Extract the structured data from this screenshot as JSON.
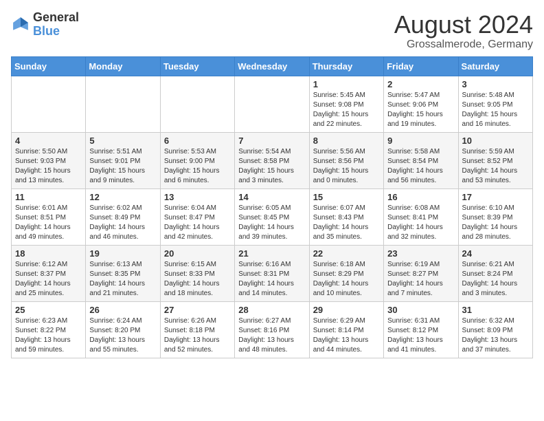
{
  "header": {
    "logo": {
      "line1": "General",
      "line2": "Blue"
    },
    "title": "August 2024",
    "location": "Grossalmerode, Germany"
  },
  "days_of_week": [
    "Sunday",
    "Monday",
    "Tuesday",
    "Wednesday",
    "Thursday",
    "Friday",
    "Saturday"
  ],
  "weeks": [
    [
      {
        "day": "",
        "info": ""
      },
      {
        "day": "",
        "info": ""
      },
      {
        "day": "",
        "info": ""
      },
      {
        "day": "",
        "info": ""
      },
      {
        "day": "1",
        "info": "Sunrise: 5:45 AM\nSunset: 9:08 PM\nDaylight: 15 hours\nand 22 minutes."
      },
      {
        "day": "2",
        "info": "Sunrise: 5:47 AM\nSunset: 9:06 PM\nDaylight: 15 hours\nand 19 minutes."
      },
      {
        "day": "3",
        "info": "Sunrise: 5:48 AM\nSunset: 9:05 PM\nDaylight: 15 hours\nand 16 minutes."
      }
    ],
    [
      {
        "day": "4",
        "info": "Sunrise: 5:50 AM\nSunset: 9:03 PM\nDaylight: 15 hours\nand 13 minutes."
      },
      {
        "day": "5",
        "info": "Sunrise: 5:51 AM\nSunset: 9:01 PM\nDaylight: 15 hours\nand 9 minutes."
      },
      {
        "day": "6",
        "info": "Sunrise: 5:53 AM\nSunset: 9:00 PM\nDaylight: 15 hours\nand 6 minutes."
      },
      {
        "day": "7",
        "info": "Sunrise: 5:54 AM\nSunset: 8:58 PM\nDaylight: 15 hours\nand 3 minutes."
      },
      {
        "day": "8",
        "info": "Sunrise: 5:56 AM\nSunset: 8:56 PM\nDaylight: 15 hours\nand 0 minutes."
      },
      {
        "day": "9",
        "info": "Sunrise: 5:58 AM\nSunset: 8:54 PM\nDaylight: 14 hours\nand 56 minutes."
      },
      {
        "day": "10",
        "info": "Sunrise: 5:59 AM\nSunset: 8:52 PM\nDaylight: 14 hours\nand 53 minutes."
      }
    ],
    [
      {
        "day": "11",
        "info": "Sunrise: 6:01 AM\nSunset: 8:51 PM\nDaylight: 14 hours\nand 49 minutes."
      },
      {
        "day": "12",
        "info": "Sunrise: 6:02 AM\nSunset: 8:49 PM\nDaylight: 14 hours\nand 46 minutes."
      },
      {
        "day": "13",
        "info": "Sunrise: 6:04 AM\nSunset: 8:47 PM\nDaylight: 14 hours\nand 42 minutes."
      },
      {
        "day": "14",
        "info": "Sunrise: 6:05 AM\nSunset: 8:45 PM\nDaylight: 14 hours\nand 39 minutes."
      },
      {
        "day": "15",
        "info": "Sunrise: 6:07 AM\nSunset: 8:43 PM\nDaylight: 14 hours\nand 35 minutes."
      },
      {
        "day": "16",
        "info": "Sunrise: 6:08 AM\nSunset: 8:41 PM\nDaylight: 14 hours\nand 32 minutes."
      },
      {
        "day": "17",
        "info": "Sunrise: 6:10 AM\nSunset: 8:39 PM\nDaylight: 14 hours\nand 28 minutes."
      }
    ],
    [
      {
        "day": "18",
        "info": "Sunrise: 6:12 AM\nSunset: 8:37 PM\nDaylight: 14 hours\nand 25 minutes."
      },
      {
        "day": "19",
        "info": "Sunrise: 6:13 AM\nSunset: 8:35 PM\nDaylight: 14 hours\nand 21 minutes."
      },
      {
        "day": "20",
        "info": "Sunrise: 6:15 AM\nSunset: 8:33 PM\nDaylight: 14 hours\nand 18 minutes."
      },
      {
        "day": "21",
        "info": "Sunrise: 6:16 AM\nSunset: 8:31 PM\nDaylight: 14 hours\nand 14 minutes."
      },
      {
        "day": "22",
        "info": "Sunrise: 6:18 AM\nSunset: 8:29 PM\nDaylight: 14 hours\nand 10 minutes."
      },
      {
        "day": "23",
        "info": "Sunrise: 6:19 AM\nSunset: 8:27 PM\nDaylight: 14 hours\nand 7 minutes."
      },
      {
        "day": "24",
        "info": "Sunrise: 6:21 AM\nSunset: 8:24 PM\nDaylight: 14 hours\nand 3 minutes."
      }
    ],
    [
      {
        "day": "25",
        "info": "Sunrise: 6:23 AM\nSunset: 8:22 PM\nDaylight: 13 hours\nand 59 minutes."
      },
      {
        "day": "26",
        "info": "Sunrise: 6:24 AM\nSunset: 8:20 PM\nDaylight: 13 hours\nand 55 minutes."
      },
      {
        "day": "27",
        "info": "Sunrise: 6:26 AM\nSunset: 8:18 PM\nDaylight: 13 hours\nand 52 minutes."
      },
      {
        "day": "28",
        "info": "Sunrise: 6:27 AM\nSunset: 8:16 PM\nDaylight: 13 hours\nand 48 minutes."
      },
      {
        "day": "29",
        "info": "Sunrise: 6:29 AM\nSunset: 8:14 PM\nDaylight: 13 hours\nand 44 minutes."
      },
      {
        "day": "30",
        "info": "Sunrise: 6:31 AM\nSunset: 8:12 PM\nDaylight: 13 hours\nand 41 minutes."
      },
      {
        "day": "31",
        "info": "Sunrise: 6:32 AM\nSunset: 8:09 PM\nDaylight: 13 hours\nand 37 minutes."
      }
    ]
  ]
}
